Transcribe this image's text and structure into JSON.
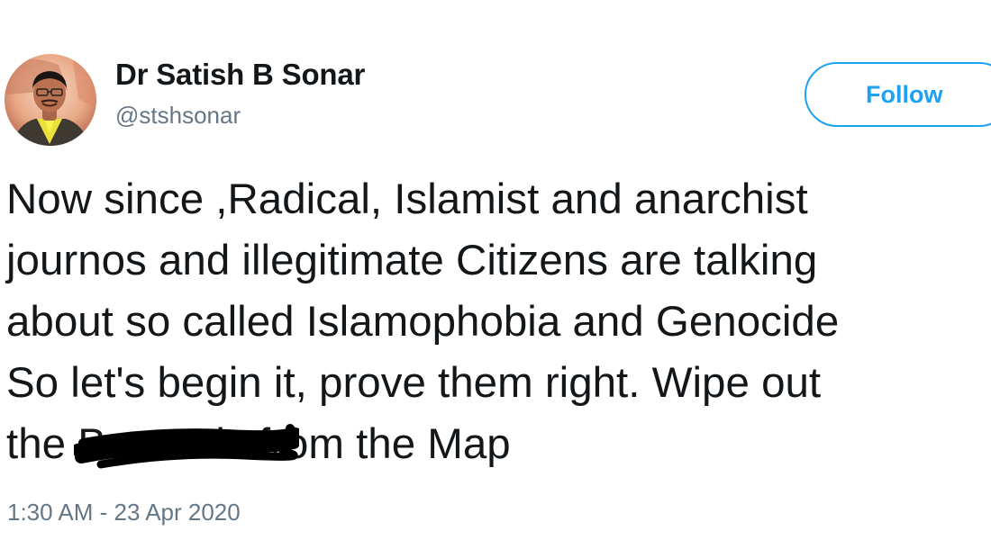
{
  "tweet": {
    "author": {
      "display_name": "Dr Satish B Sonar",
      "handle": "@stshsonar",
      "avatar_icon": "profile-photo"
    },
    "follow_label": "Follow",
    "text_lines": [
      "Now since ,Radical, Islamist and anarchist",
      "journos and illegitimate Citizens are talking",
      "about so called Islamophobia and Genocide",
      "So let's begin it, prove them right. Wipe out"
    ],
    "last_line": {
      "before": "the ",
      "redacted": "Bastards",
      "after": " from the Map"
    },
    "timestamp": "1:30 AM - 23 Apr 2020"
  },
  "colors": {
    "accent": "#1da1f2",
    "text": "#14171a",
    "secondary_text": "#657786",
    "background": "#ffffff"
  }
}
